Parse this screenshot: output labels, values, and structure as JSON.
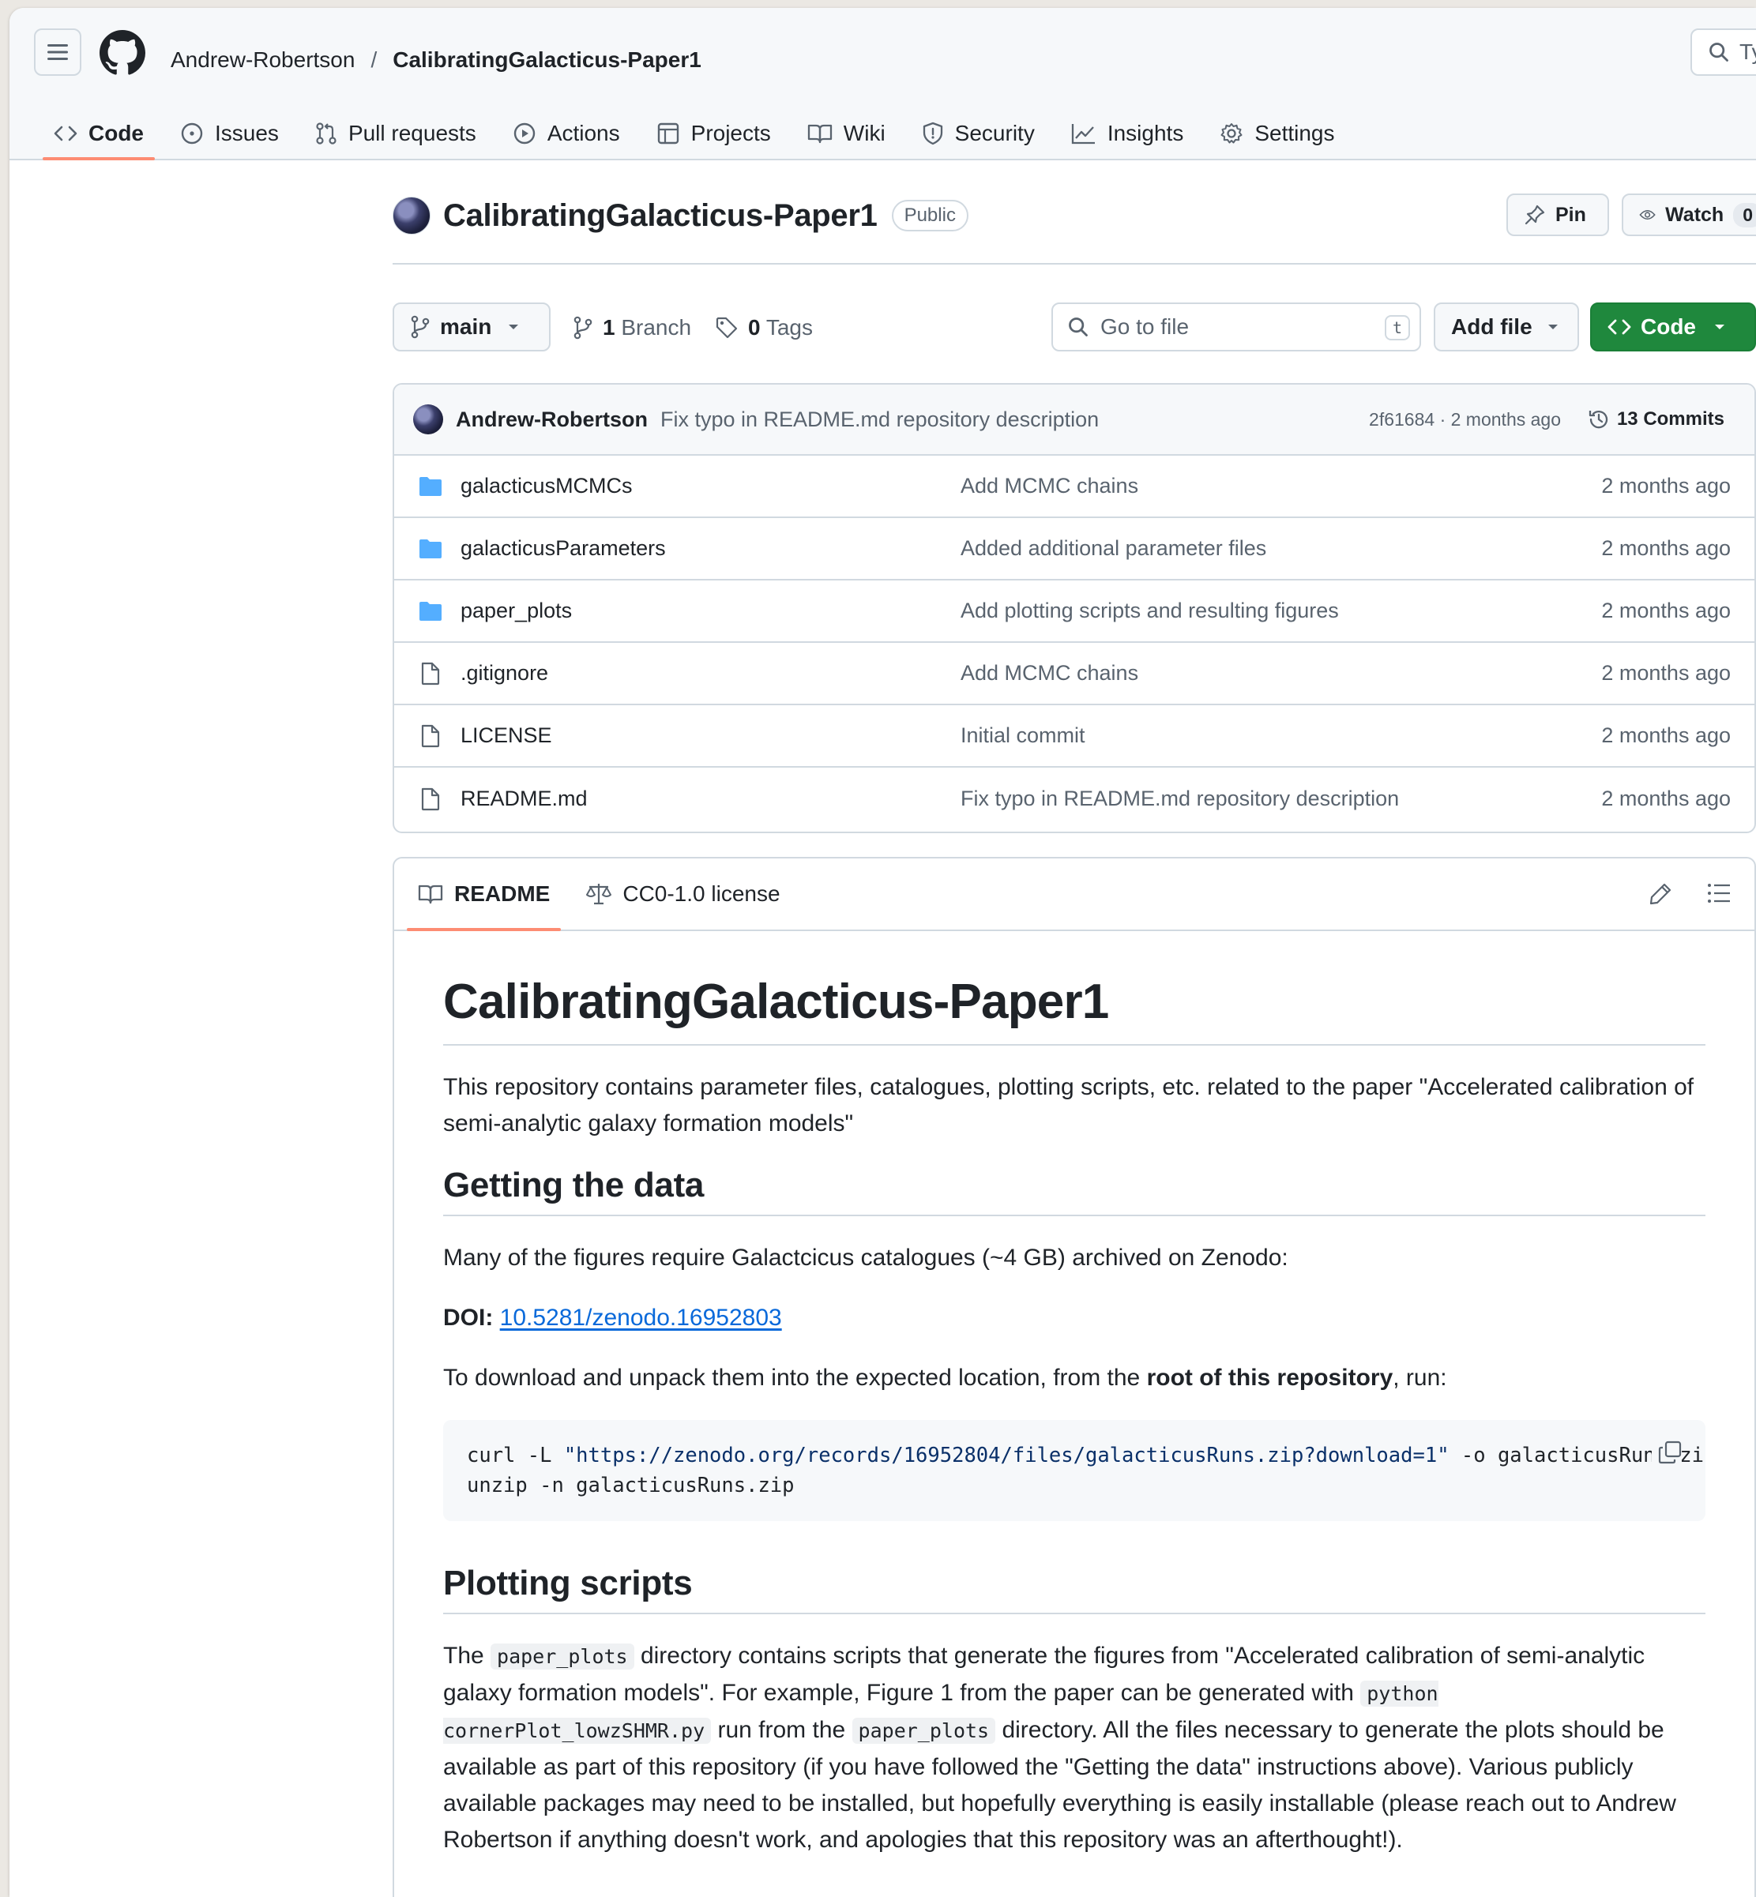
{
  "header": {
    "owner": "Andrew-Robertson",
    "slash": "/",
    "repo": "CalibratingGalacticus-Paper1",
    "search_partial": "Ty"
  },
  "tabs": [
    {
      "label": "Code",
      "icon": "code-icon"
    },
    {
      "label": "Issues",
      "icon": "issue-icon"
    },
    {
      "label": "Pull requests",
      "icon": "pull-request-icon"
    },
    {
      "label": "Actions",
      "icon": "actions-play-icon"
    },
    {
      "label": "Projects",
      "icon": "projects-table-icon"
    },
    {
      "label": "Wiki",
      "icon": "book-icon"
    },
    {
      "label": "Security",
      "icon": "shield-icon"
    },
    {
      "label": "Insights",
      "icon": "graph-icon"
    },
    {
      "label": "Settings",
      "icon": "gear-icon"
    }
  ],
  "repo_head": {
    "name": "CalibratingGalacticus-Paper1",
    "visibility": "Public",
    "pin_label": "Pin",
    "watch_label": "Watch",
    "watch_count": "0"
  },
  "toolbar": {
    "branch": "main",
    "branch_count": "1",
    "branch_label": "Branch",
    "tag_count": "0",
    "tag_label": "Tags",
    "goto_placeholder": "Go to file",
    "goto_kbd": "t",
    "add_file": "Add file",
    "code": "Code"
  },
  "latest_commit": {
    "author": "Andrew-Robertson",
    "message": "Fix typo in README.md repository description",
    "meta": "2f61684 · 2 months ago",
    "commits": "13 Commits"
  },
  "files": [
    {
      "type": "folder",
      "name": "galacticusMCMCs",
      "message": "Add MCMC chains",
      "age": "2 months ago"
    },
    {
      "type": "folder",
      "name": "galacticusParameters",
      "message": "Added additional parameter files",
      "age": "2 months ago"
    },
    {
      "type": "folder",
      "name": "paper_plots",
      "message": "Add plotting scripts and resulting figures",
      "age": "2 months ago"
    },
    {
      "type": "file",
      "name": ".gitignore",
      "message": "Add MCMC chains",
      "age": "2 months ago"
    },
    {
      "type": "file",
      "name": "LICENSE",
      "message": "Initial commit",
      "age": "2 months ago"
    },
    {
      "type": "file",
      "name": "README.md",
      "message": "Fix typo in README.md repository description",
      "age": "2 months ago"
    }
  ],
  "readme": {
    "tab_readme": "README",
    "tab_license": "CC0-1.0 license",
    "title": "CalibratingGalacticus-Paper1",
    "intro": "This repository contains parameter files, catalogues, plotting scripts, etc. related to the paper \"Accelerated calibration of semi-analytic galaxy formation models\"",
    "h2_data": "Getting the data",
    "data_p": "Many of the figures require Galactcicus catalogues (~4 GB) archived on Zenodo:",
    "doi_label": "DOI:",
    "doi_value": "10.5281/zenodo.16952803",
    "download_p_pre": "To download and unpack them into the expected location, from the ",
    "download_p_bold": "root of this repository",
    "download_p_post": ", run:",
    "code_line1_pre": "curl -L ",
    "code_line1_url": "\"https://zenodo.org/records/16952804/files/galacticusRuns.zip?download=1\"",
    "code_line1_post": " -o galacticusRuns.zip",
    "code_line2": "unzip -n galacticusRuns.zip",
    "h2_plot": "Plotting scripts",
    "plot_p1": "The ",
    "plot_code1": "paper_plots",
    "plot_p2": " directory contains scripts that generate the figures from \"Accelerated calibration of semi-analytic galaxy formation models\". For example, Figure 1 from the paper can be generated with ",
    "plot_code2": "python cornerPlot_lowzSHMR.py",
    "plot_p3": " run from the ",
    "plot_code3": "paper_plots",
    "plot_p4": " directory. All the files necessary to generate the plots should be available as part of this repository (if you have followed the \"Getting the data\" instructions above). Various publicly available packages may need to be installed, but hopefully everything is easily installable (please reach out to Andrew Robertson if anything doesn't work, and apologies that this repository was an afterthought!)."
  },
  "colors": {
    "accent_underline": "#fd8c73",
    "primary_button": "#1f883d",
    "link": "#0969da",
    "folder": "#54aeff",
    "muted_text": "#59636e"
  }
}
